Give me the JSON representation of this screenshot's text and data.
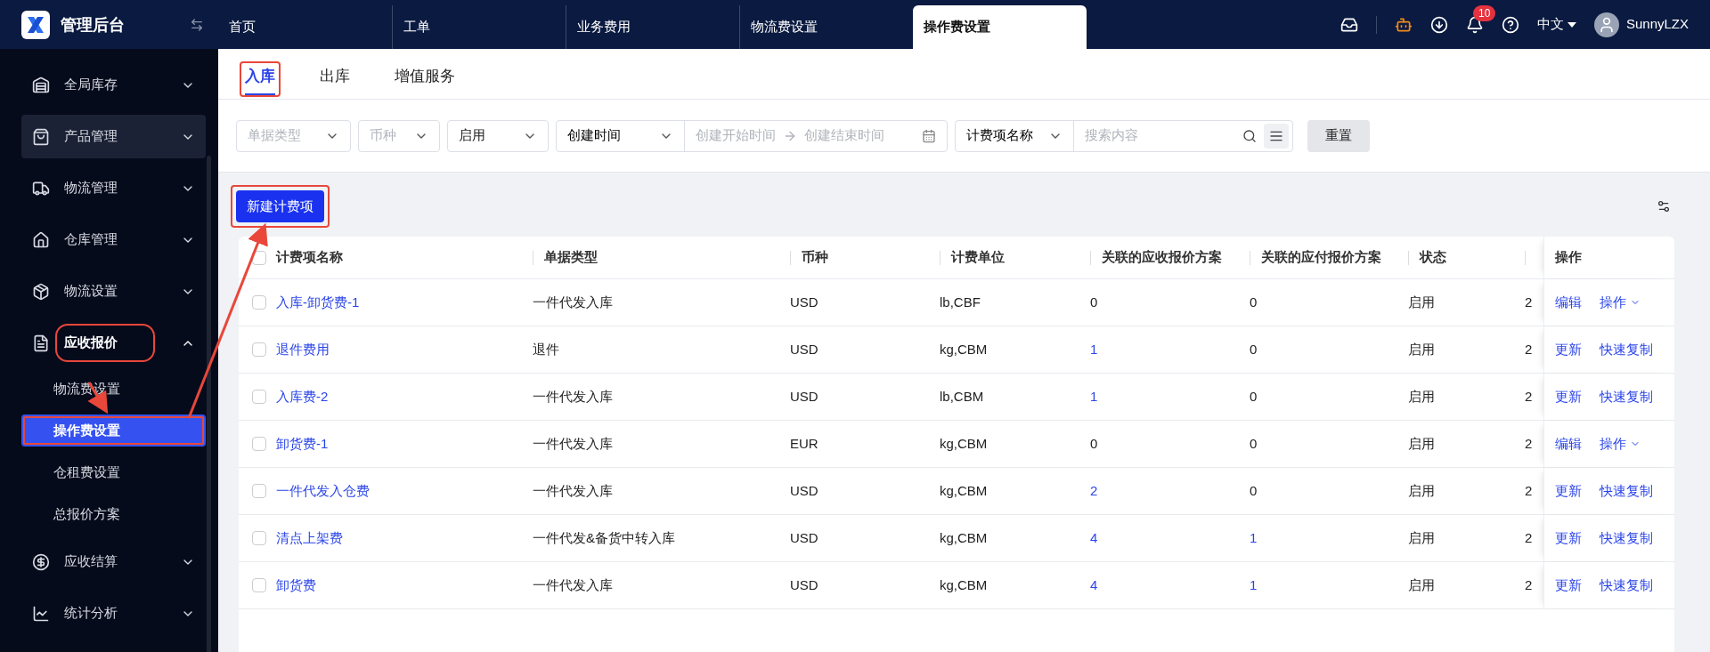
{
  "app": {
    "title": "管理后台"
  },
  "top_tabs": [
    {
      "label": "首页",
      "selected": false
    },
    {
      "label": "工单",
      "selected": false
    },
    {
      "label": "业务费用",
      "selected": false
    },
    {
      "label": "物流费设置",
      "selected": false
    },
    {
      "label": "操作费设置",
      "selected": true
    }
  ],
  "header": {
    "notification_count": "10",
    "language": "中文",
    "user": "SunnyLZX"
  },
  "sidebar": {
    "items": [
      {
        "label": "全局库存",
        "expanded": false,
        "selected": false,
        "annotated": false
      },
      {
        "label": "产品管理",
        "expanded": false,
        "selected": true,
        "annotated": false
      },
      {
        "label": "物流管理",
        "expanded": false,
        "selected": false,
        "annotated": false
      },
      {
        "label": "仓库管理",
        "expanded": false,
        "selected": false,
        "annotated": false
      },
      {
        "label": "物流设置",
        "expanded": false,
        "selected": false,
        "annotated": false
      },
      {
        "label": "应收报价",
        "expanded": true,
        "selected": false,
        "annotated": true,
        "children": [
          {
            "label": "物流费设置",
            "selected": false,
            "annotated": false
          },
          {
            "label": "操作费设置",
            "selected": true,
            "annotated": true
          },
          {
            "label": "仓租费设置",
            "selected": false,
            "annotated": false
          },
          {
            "label": "总报价方案",
            "selected": false,
            "annotated": false
          }
        ]
      },
      {
        "label": "应收结算",
        "expanded": false,
        "selected": false,
        "annotated": false
      },
      {
        "label": "统计分析",
        "expanded": false,
        "selected": false,
        "annotated": false
      }
    ]
  },
  "sub_tabs": [
    {
      "label": "入库",
      "selected": true,
      "annotated": true
    },
    {
      "label": "出库",
      "selected": false,
      "annotated": false
    },
    {
      "label": "增值服务",
      "selected": false,
      "annotated": false
    }
  ],
  "filters": {
    "doc_type": {
      "placeholder": "单据类型"
    },
    "currency": {
      "placeholder": "币种"
    },
    "status": {
      "value": "启用"
    },
    "time_field": {
      "value": "创建时间"
    },
    "start": {
      "placeholder": "创建开始时间"
    },
    "end": {
      "placeholder": "创建结束时间"
    },
    "search_field": {
      "value": "计费项名称"
    },
    "search": {
      "placeholder": "搜索内容"
    },
    "reset": "重置"
  },
  "new_button": {
    "label": "新建计费项",
    "annotated": true
  },
  "table": {
    "all_checked": false,
    "columns": [
      "计费项名称",
      "单据类型",
      "币种",
      "计费单位",
      "关联的应收报价方案",
      "关联的应付报价方案",
      "状态",
      "操作"
    ],
    "rows": [
      {
        "checked": false,
        "name": "入库-卸货费-1",
        "doc_type": "一件代发入库",
        "currency": "USD",
        "unit": "lb,CBF",
        "recv": "0",
        "recv_link": false,
        "pay": "0",
        "pay_link": false,
        "status": "启用",
        "column_8": "2",
        "actions": [
          {
            "label": "编辑",
            "has_menu": false
          },
          {
            "label": "操作",
            "has_menu": true
          }
        ]
      },
      {
        "checked": false,
        "name": "退件费用",
        "doc_type": "退件",
        "currency": "USD",
        "unit": "kg,CBM",
        "recv": "1",
        "recv_link": true,
        "pay": "0",
        "pay_link": false,
        "status": "启用",
        "column_8": "2",
        "actions": [
          {
            "label": "更新",
            "has_menu": false
          },
          {
            "label": "快速复制",
            "has_menu": false
          }
        ]
      },
      {
        "checked": false,
        "name": "入库费-2",
        "doc_type": "一件代发入库",
        "currency": "USD",
        "unit": "lb,CBM",
        "recv": "1",
        "recv_link": true,
        "pay": "0",
        "pay_link": false,
        "status": "启用",
        "column_8": "2",
        "actions": [
          {
            "label": "更新",
            "has_menu": false
          },
          {
            "label": "快速复制",
            "has_menu": false
          }
        ]
      },
      {
        "checked": false,
        "name": "卸货费-1",
        "doc_type": "一件代发入库",
        "currency": "EUR",
        "unit": "kg,CBM",
        "recv": "0",
        "recv_link": false,
        "pay": "0",
        "pay_link": false,
        "status": "启用",
        "column_8": "2",
        "actions": [
          {
            "label": "编辑",
            "has_menu": false
          },
          {
            "label": "操作",
            "has_menu": true
          }
        ]
      },
      {
        "checked": false,
        "name": "一件代发入仓费",
        "doc_type": "一件代发入库",
        "currency": "USD",
        "unit": "kg,CBM",
        "recv": "2",
        "recv_link": true,
        "pay": "0",
        "pay_link": false,
        "status": "启用",
        "column_8": "2",
        "actions": [
          {
            "label": "更新",
            "has_menu": false
          },
          {
            "label": "快速复制",
            "has_menu": false
          }
        ]
      },
      {
        "checked": false,
        "name": "清点上架费",
        "doc_type": "一件代发&备货中转入库",
        "currency": "USD",
        "unit": "kg,CBM",
        "recv": "4",
        "recv_link": true,
        "pay": "1",
        "pay_link": true,
        "status": "启用",
        "column_8": "2",
        "actions": [
          {
            "label": "更新",
            "has_menu": false
          },
          {
            "label": "快速复制",
            "has_menu": false
          }
        ]
      },
      {
        "checked": false,
        "name": "卸货费",
        "doc_type": "一件代发入库",
        "currency": "USD",
        "unit": "kg,CBM",
        "recv": "4",
        "recv_link": true,
        "pay": "1",
        "pay_link": true,
        "status": "启用",
        "column_8": "2",
        "actions": [
          {
            "label": "更新",
            "has_menu": false
          },
          {
            "label": "快速复制",
            "has_menu": false
          }
        ]
      }
    ]
  }
}
